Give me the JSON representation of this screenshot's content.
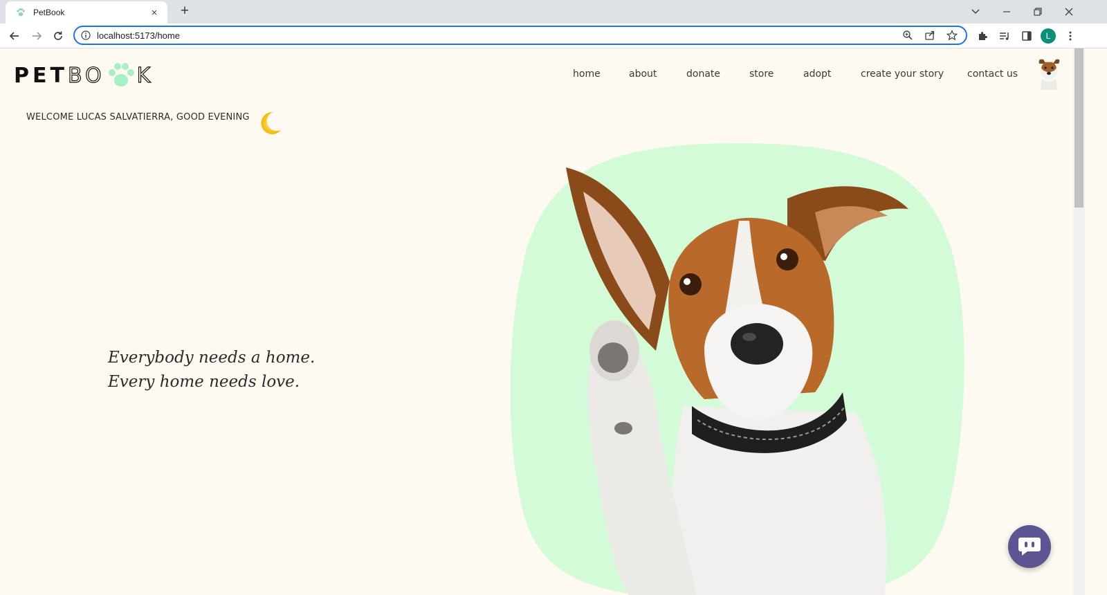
{
  "browser": {
    "tab_title": "PetBook",
    "new_tab_symbol": "+",
    "tab_close_symbol": "×",
    "url": "localhost:5173/home",
    "profile_initial": "L"
  },
  "page": {
    "logo": {
      "part1": "PET",
      "part2": "BO",
      "part3": "K"
    },
    "nav": [
      {
        "label": "home"
      },
      {
        "label": "about"
      },
      {
        "label": "donate"
      },
      {
        "label": "store"
      },
      {
        "label": "adopt"
      },
      {
        "label": "create your story"
      },
      {
        "label": "contact us"
      }
    ],
    "welcome": "WELCOME LUCAS SALVATIERRA, GOOD EVENING",
    "tagline": [
      "Everybody needs a home.",
      "Every home needs love."
    ]
  },
  "icons": {
    "moon": "crescent-moon-icon",
    "chat": "chat-bubble-icon",
    "hero": "dog-photo"
  },
  "colors": {
    "page_background": "#fef9f1",
    "hero_blob": "#d3fbd7",
    "paw_accent": "#a6f0c6",
    "chat_button": "#5d5591",
    "omnibox_focus": "#1a73e8"
  }
}
